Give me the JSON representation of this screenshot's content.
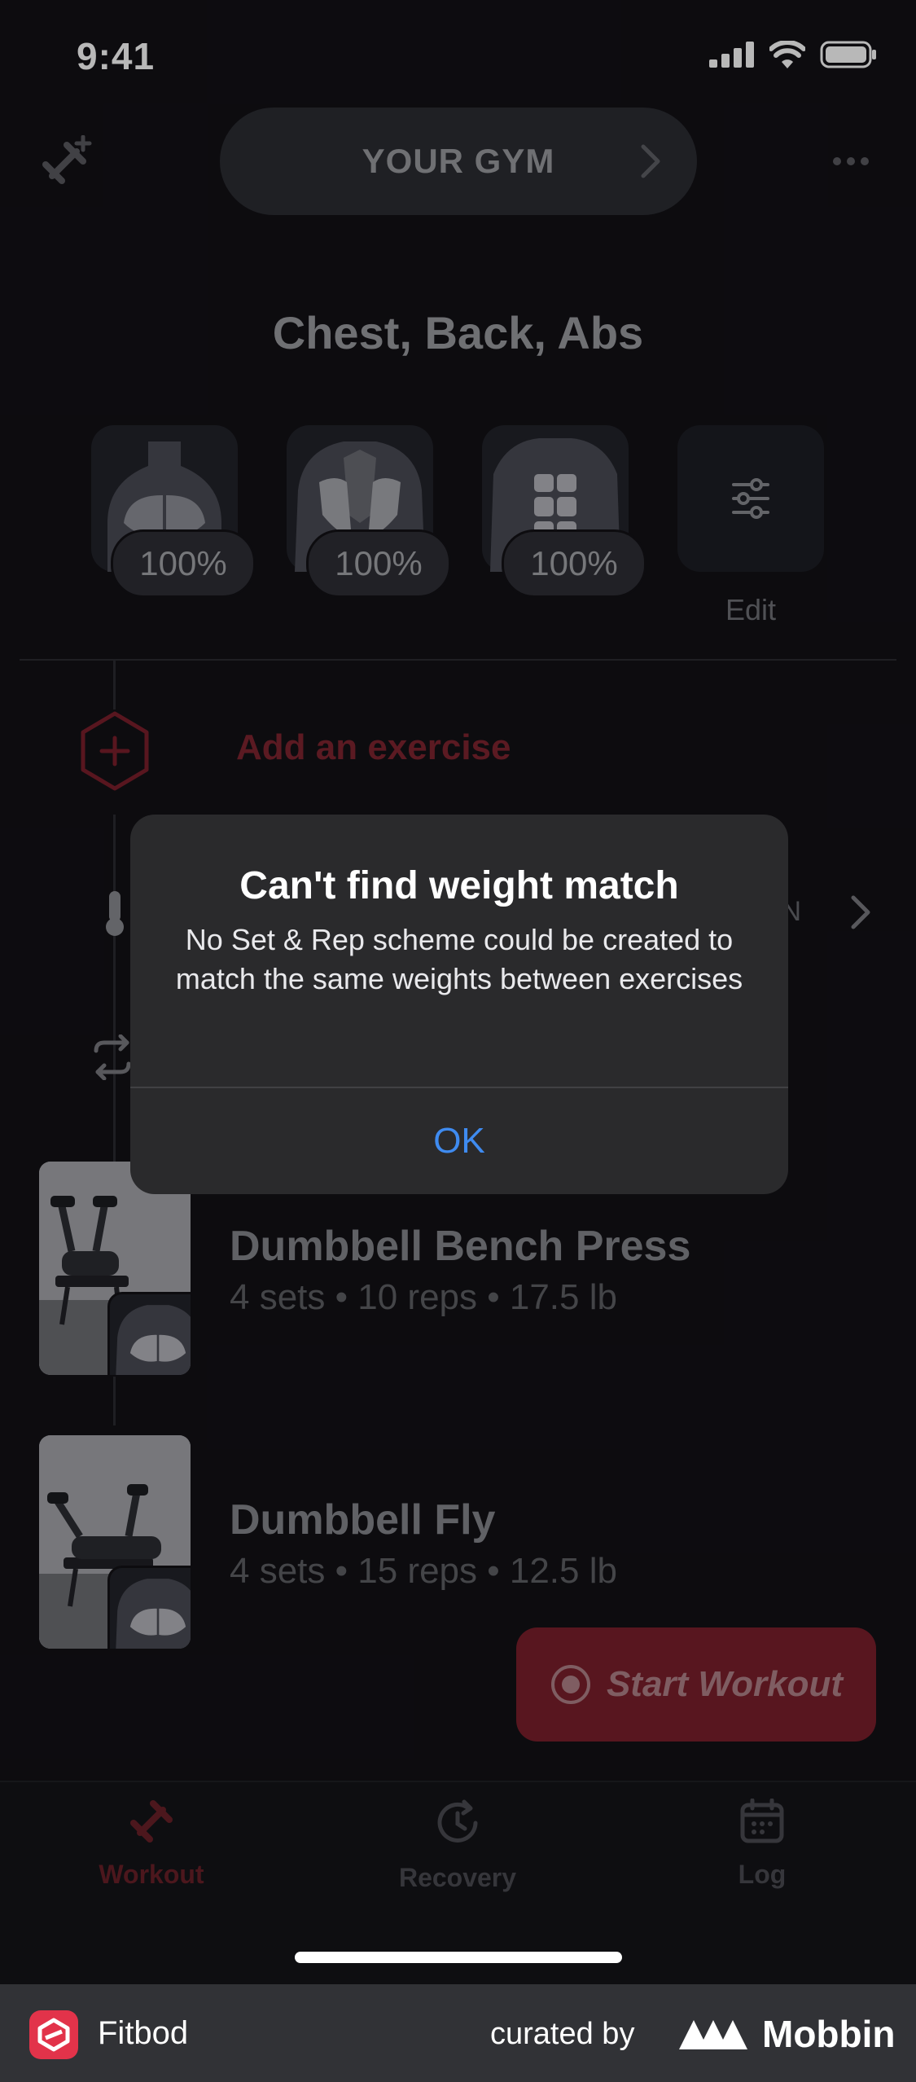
{
  "status_bar": {
    "time": "9:41"
  },
  "header": {
    "gym_label": "YOUR GYM",
    "title": "Chest, Back, Abs"
  },
  "muscles": [
    {
      "name": "chest",
      "percent": "100%"
    },
    {
      "name": "back",
      "percent": "100%"
    },
    {
      "name": "abs",
      "percent": "100%"
    }
  ],
  "edit_label": "Edit",
  "add_exercise": "Add an exercise",
  "partial_text": "IN",
  "exercises": [
    {
      "name": "Dumbbell Bench Press",
      "details": "4 sets • 10 reps • 17.5 lb"
    },
    {
      "name": "Dumbbell Fly",
      "details": "4 sets • 15 reps • 12.5 lb"
    }
  ],
  "start_workout": "Start Workout",
  "tabs": [
    {
      "label": "Workout",
      "active": true
    },
    {
      "label": "Recovery",
      "active": false
    },
    {
      "label": "Log",
      "active": false
    }
  ],
  "dialog": {
    "title": "Can't find weight match",
    "message": "No Set & Rep scheme could be created to match the same weights between exercises",
    "ok": "OK"
  },
  "footer": {
    "app_name": "Fitbod",
    "curated_by": "curated by",
    "brand": "Mobbin"
  },
  "colors": {
    "accent": "#7a1f2b",
    "link_blue": "#3f8bf0",
    "background": "#121116"
  }
}
